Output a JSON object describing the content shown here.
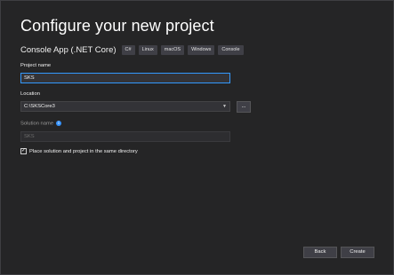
{
  "header": {
    "title": "Configure your new project"
  },
  "template": {
    "name": "Console App (.NET Core)",
    "tags": [
      "C#",
      "Linux",
      "macOS",
      "Windows",
      "Console"
    ]
  },
  "form": {
    "project_name_label": "Project name",
    "project_name_value": "SKS",
    "location_label": "Location",
    "location_value": "C:\\SKSCore3",
    "browse_label": "...",
    "solution_name_label": "Solution name",
    "solution_name_value": "SKS",
    "same_directory_checked": true,
    "same_directory_label": "Place solution and project in the same directory"
  },
  "footer": {
    "back_label": "Back",
    "create_label": "Create"
  },
  "colors": {
    "background": "#252526",
    "focus_accent": "#3399ff",
    "info_icon": "#3794ff"
  },
  "icons": {
    "info": "info-icon",
    "dropdown": "chevron-down-icon",
    "check": "checkmark-icon"
  }
}
